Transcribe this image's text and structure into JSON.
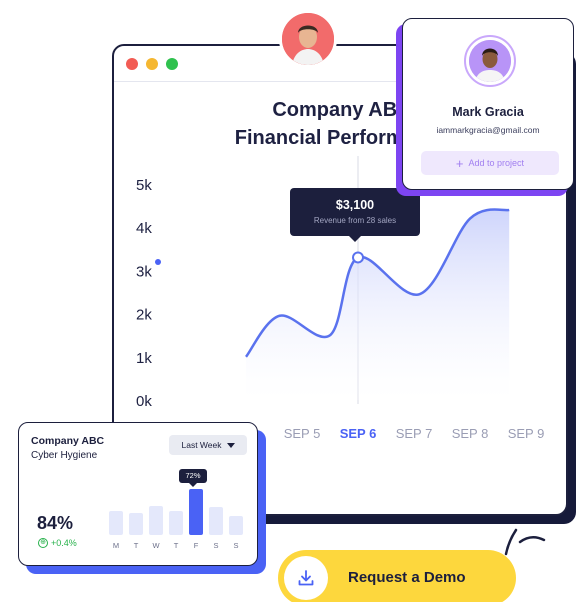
{
  "window": {
    "title_line1": "Company ABC",
    "title_line2": "Financial Performance"
  },
  "chart_data": {
    "type": "area",
    "title": "Company ABC Financial Performance",
    "y_ticks": [
      "5k",
      "4k",
      "3k",
      "2k",
      "1k",
      "0k"
    ],
    "x_ticks": [
      "SEP 5",
      "SEP 6",
      "SEP 7",
      "SEP 8",
      "SEP 9"
    ],
    "highlighted_tick": "SEP 6",
    "ylim": [
      0,
      5000
    ],
    "curve": [
      {
        "x": 2.0,
        "y": 1000
      },
      {
        "x": 2.6,
        "y": 1950
      },
      {
        "x": 3.5,
        "y": 1500
      },
      {
        "x": 4.0,
        "y": 3300
      },
      {
        "x": 5.1,
        "y": 2450
      },
      {
        "x": 6.0,
        "y": 4200
      },
      {
        "x": 6.7,
        "y": 4400
      }
    ],
    "x_index_of_ticks": [
      3,
      4,
      5,
      6,
      7
    ],
    "highlight_point": {
      "x": 4.0,
      "y": 3300
    },
    "colors": {
      "line": "#5a72ee",
      "fill_top": "#c9d0fb",
      "fill_bottom": "#ffffff"
    }
  },
  "tooltip": {
    "amount": "$3,100",
    "subtitle": "Revenue from 28 sales"
  },
  "profile": {
    "name": "Mark Gracia",
    "email": "iammarkgracia@gmail.com",
    "add_label": "Add to project",
    "plus_glyph": "+"
  },
  "hygiene": {
    "company": "Company ABC",
    "subtitle": "Cyber Hygiene",
    "dropdown": "Last Week",
    "percent": "84%",
    "delta": "+0.4%",
    "delta_icon": "⊕",
    "badge": "72%",
    "days": [
      "M",
      "T",
      "W",
      "T",
      "F",
      "S",
      "S"
    ],
    "values": [
      0.52,
      0.48,
      0.62,
      0.52,
      1.0,
      0.6,
      0.42
    ],
    "active_index": 4
  },
  "demo": {
    "label": "Request a Demo",
    "icon": "download-icon"
  },
  "colors": {
    "accent_blue": "#4a62f5",
    "accent_purple": "#7d45f2",
    "accent_yellow": "#fdd73d",
    "dark": "#1c1f3d",
    "positive": "#27b14b"
  }
}
